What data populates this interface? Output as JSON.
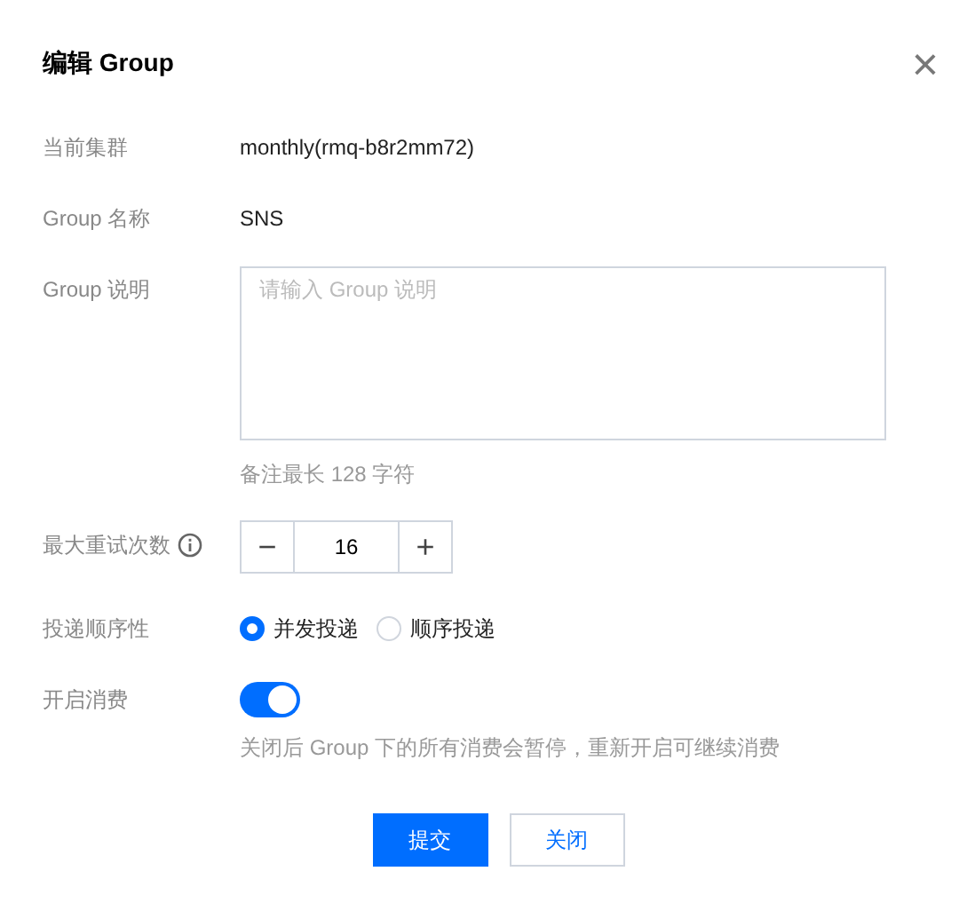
{
  "dialog": {
    "title": "编辑 Group",
    "close": "×"
  },
  "fields": [
    {
      "kind": "text",
      "label": "当前集群",
      "value": "monthly(rmq-b8r2mm72)"
    },
    {
      "kind": "text",
      "label": "Group 名称",
      "value": "SNS"
    },
    {
      "kind": "textarea",
      "label": "Group 说明",
      "placeholder": "请输入 Group 说明",
      "hint": "备注最长 128 字符"
    },
    {
      "kind": "stepper",
      "label": "最大重试次数",
      "info": true,
      "minus": "−",
      "value": "16",
      "plus": "+"
    },
    {
      "kind": "radio",
      "label": "投递顺序性",
      "options": [
        {
          "label": "并发投递",
          "selected": true
        },
        {
          "label": "顺序投递",
          "selected": false
        }
      ]
    },
    {
      "kind": "switch",
      "label": "开启消费",
      "on": true,
      "hint": "关闭后 Group 下的所有消费会暂停，重新开启可继续消费"
    }
  ],
  "buttons": [
    {
      "label": "提交",
      "primary": true
    },
    {
      "label": "关闭",
      "primary": false
    }
  ]
}
